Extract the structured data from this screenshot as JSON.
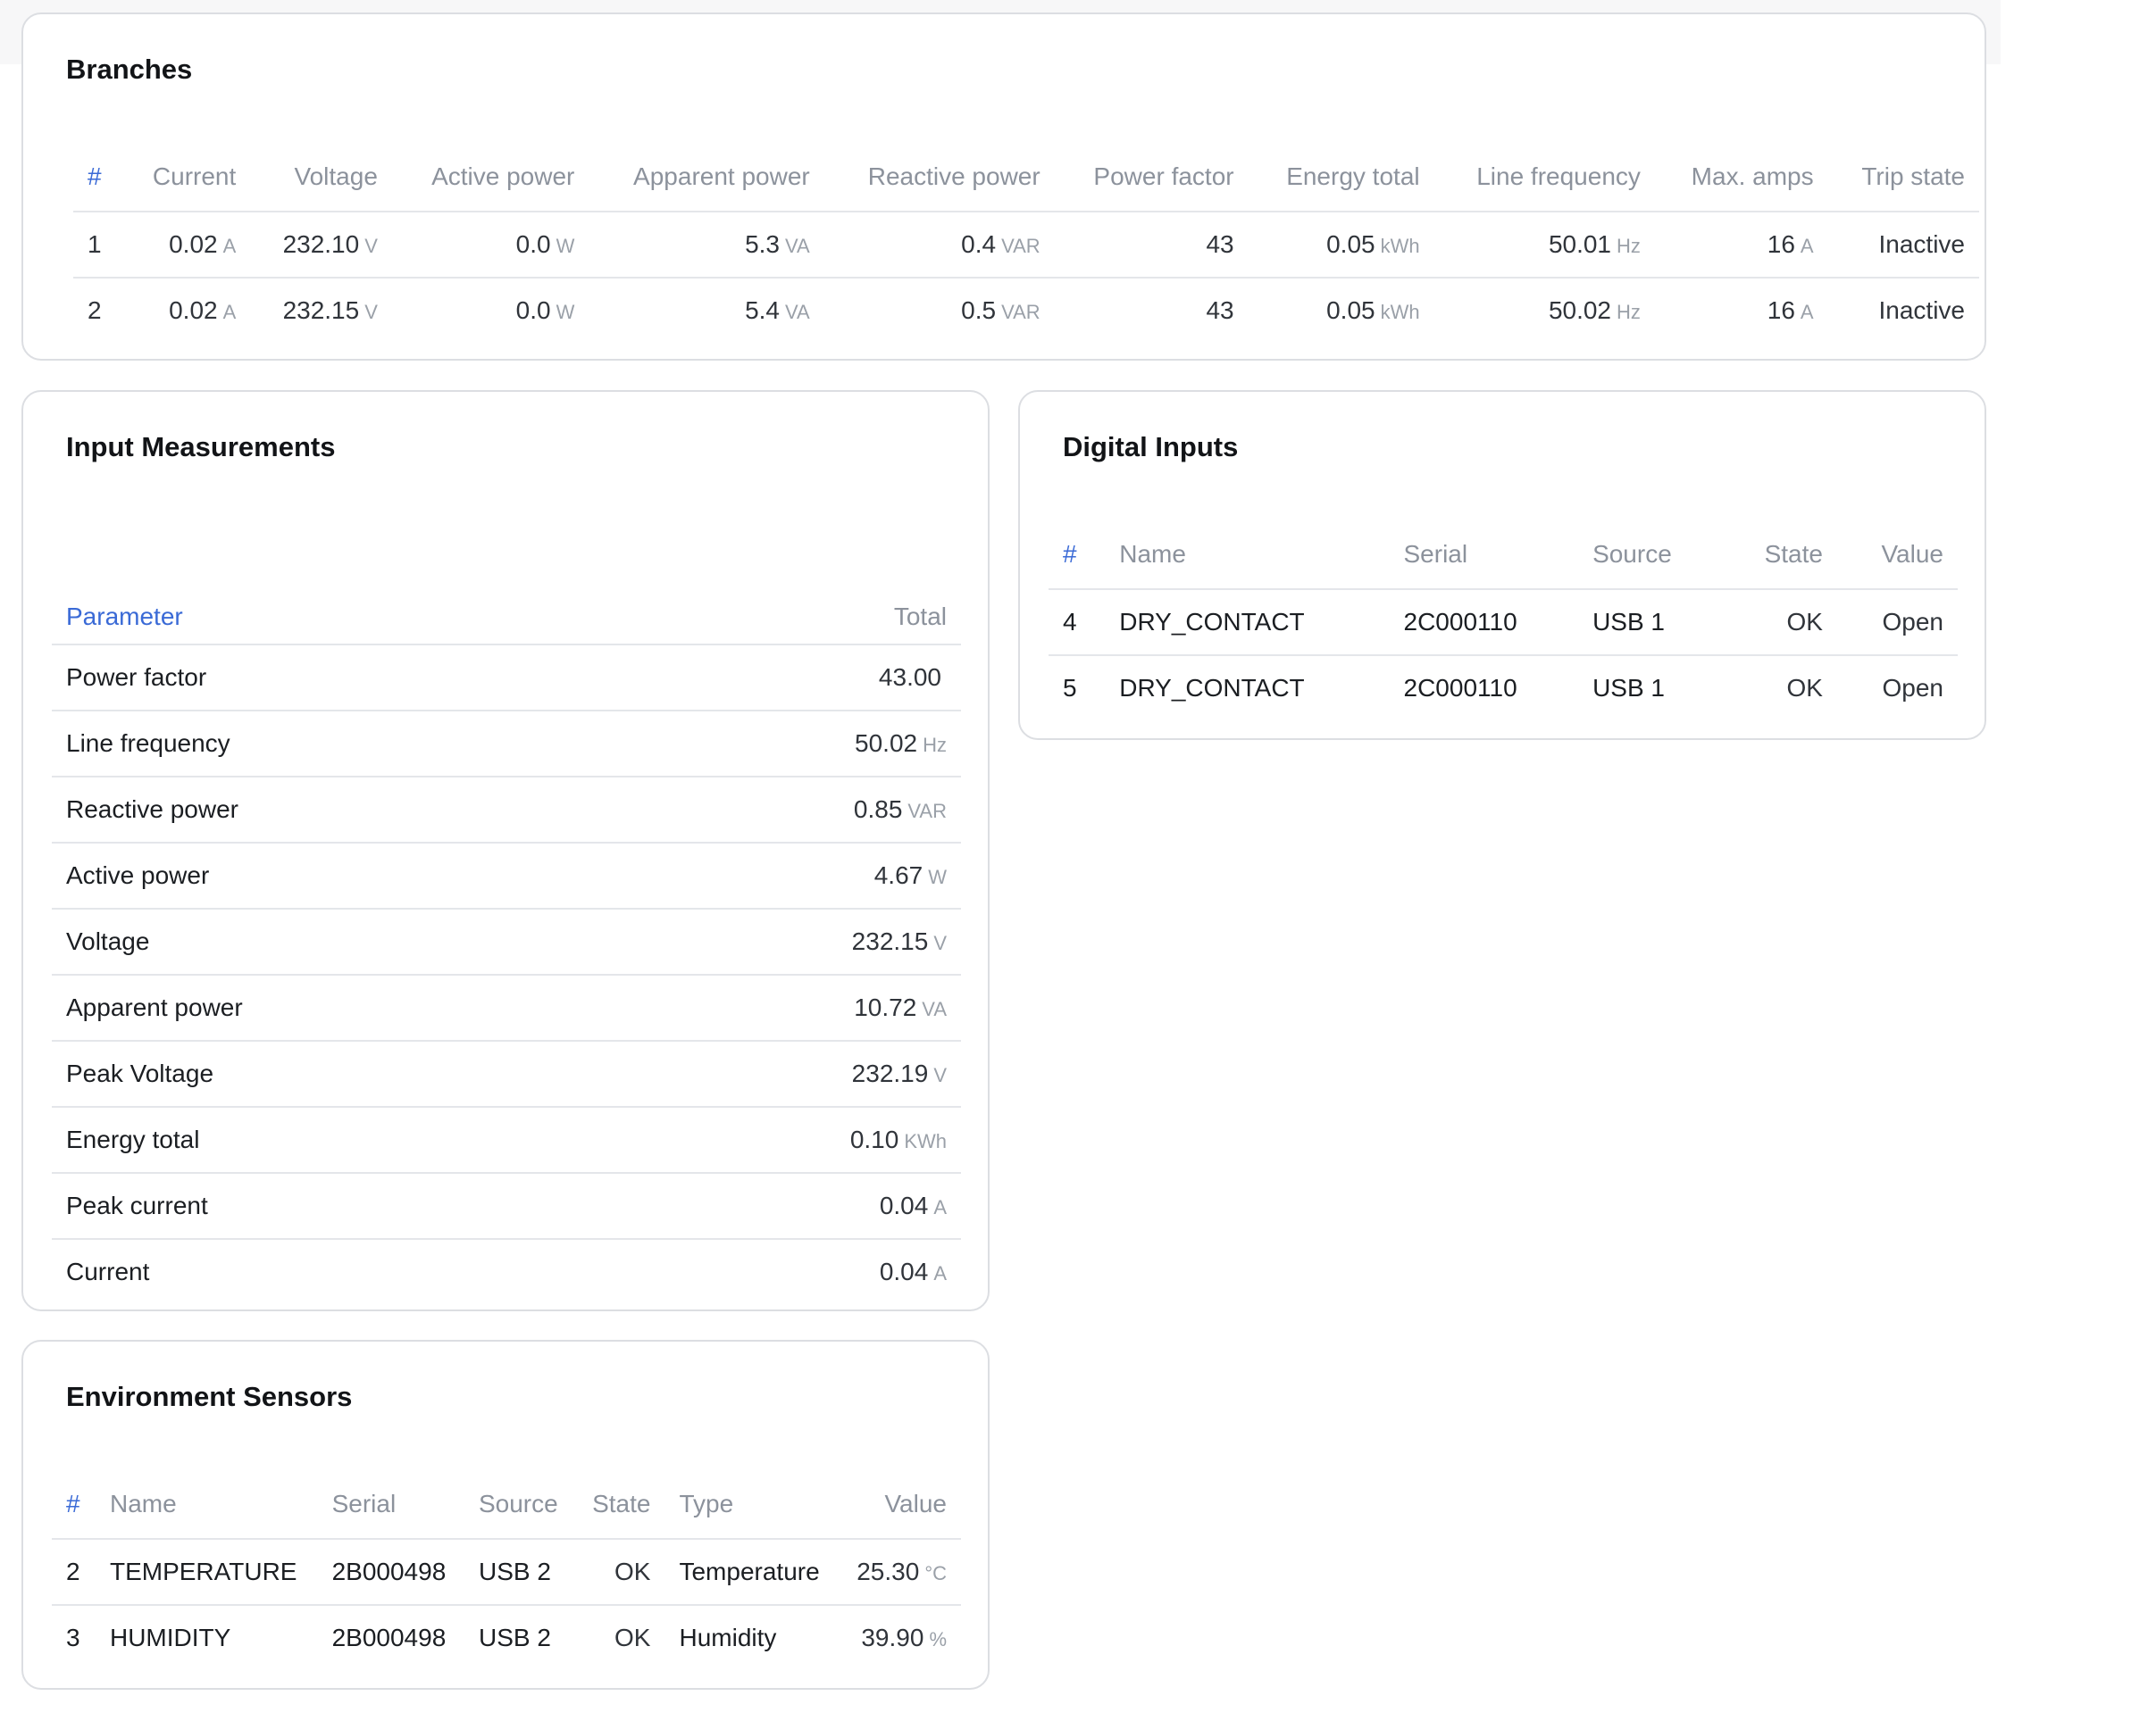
{
  "branches": {
    "title": "Branches",
    "headers": [
      "#",
      "Current",
      "Voltage",
      "Active power",
      "Apparent power",
      "Reactive power",
      "Power factor",
      "Energy total",
      "Line frequency",
      "Max. amps",
      "Trip state"
    ],
    "rows": [
      {
        "id": "1",
        "current": "0.02",
        "current_u": "A",
        "voltage": "232.10",
        "voltage_u": "V",
        "active": "0.0",
        "active_u": "W",
        "apparent": "5.3",
        "apparent_u": "VA",
        "reactive": "0.4",
        "reactive_u": "VAR",
        "pf": "43",
        "energy": "0.05",
        "energy_u": "kWh",
        "freq": "50.01",
        "freq_u": "Hz",
        "maxamps": "16",
        "maxamps_u": "A",
        "trip": "Inactive"
      },
      {
        "id": "2",
        "current": "0.02",
        "current_u": "A",
        "voltage": "232.15",
        "voltage_u": "V",
        "active": "0.0",
        "active_u": "W",
        "apparent": "5.4",
        "apparent_u": "VA",
        "reactive": "0.5",
        "reactive_u": "VAR",
        "pf": "43",
        "energy": "0.05",
        "energy_u": "kWh",
        "freq": "50.02",
        "freq_u": "Hz",
        "maxamps": "16",
        "maxamps_u": "A",
        "trip": "Inactive"
      }
    ]
  },
  "input": {
    "title": "Input Measurements",
    "headers": [
      "Parameter",
      "Total"
    ],
    "rows": [
      {
        "param": "Power factor",
        "value": "43.00",
        "unit": ""
      },
      {
        "param": "Line frequency",
        "value": "50.02",
        "unit": "Hz"
      },
      {
        "param": "Reactive power",
        "value": "0.85",
        "unit": "VAR"
      },
      {
        "param": "Active power",
        "value": "4.67",
        "unit": "W"
      },
      {
        "param": "Voltage",
        "value": "232.15",
        "unit": "V"
      },
      {
        "param": "Apparent power",
        "value": "10.72",
        "unit": "VA"
      },
      {
        "param": "Peak Voltage",
        "value": "232.19",
        "unit": "V"
      },
      {
        "param": "Energy total",
        "value": "0.10",
        "unit": "KWh"
      },
      {
        "param": "Peak current",
        "value": "0.04",
        "unit": "A"
      },
      {
        "param": "Current",
        "value": "0.04",
        "unit": "A"
      }
    ]
  },
  "digital": {
    "title": "Digital Inputs",
    "headers": [
      "#",
      "Name",
      "Serial",
      "Source",
      "State",
      "Value"
    ],
    "rows": [
      {
        "id": "4",
        "name": "DRY_CONTACT",
        "serial": "2C000110",
        "source": "USB 1",
        "state": "OK",
        "value": "Open"
      },
      {
        "id": "5",
        "name": "DRY_CONTACT",
        "serial": "2C000110",
        "source": "USB 1",
        "state": "OK",
        "value": "Open"
      }
    ]
  },
  "env": {
    "title": "Environment Sensors",
    "headers": [
      "#",
      "Name",
      "Serial",
      "Source",
      "State",
      "Type",
      "Value"
    ],
    "rows": [
      {
        "id": "2",
        "name": "TEMPERATURE",
        "serial": "2B000498",
        "source": "USB 2",
        "state": "OK",
        "type": "Temperature",
        "value": "25.30",
        "unit": "°C"
      },
      {
        "id": "3",
        "name": "HUMIDITY",
        "serial": "2B000498",
        "source": "USB 2",
        "state": "OK",
        "type": "Humidity",
        "value": "39.90",
        "unit": "%"
      }
    ]
  },
  "colors": {
    "accent": "#3a6ad6",
    "muted": "#8c929c",
    "border": "#dcdee2"
  }
}
